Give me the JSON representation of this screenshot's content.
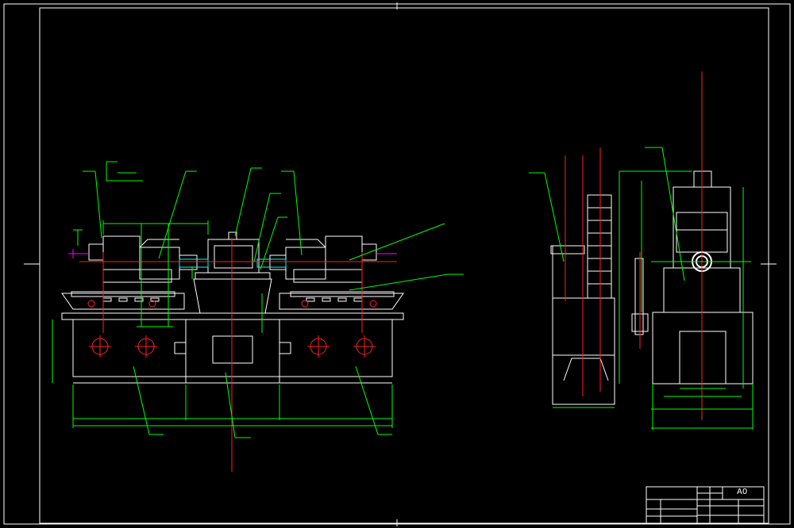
{
  "drawing": {
    "colors": {
      "background": "#000000",
      "outline": "#ffffff",
      "dimension": "#00ff00",
      "centerline": "#ff2020",
      "hatch": "#ff00ff",
      "cyan": "#00ffff",
      "annotation": "#00ff00"
    }
  },
  "title_block": {
    "title": "",
    "sheet_size": "A0"
  }
}
